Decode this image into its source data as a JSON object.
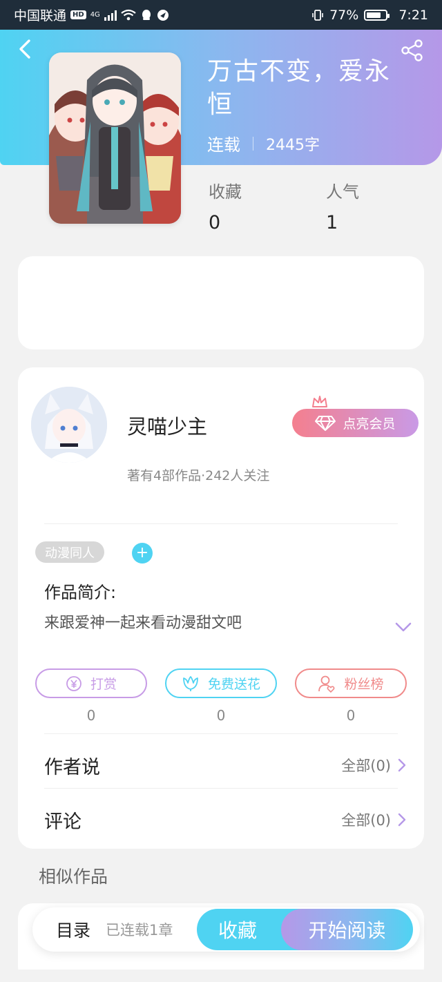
{
  "status_bar": {
    "carrier": "中国联通",
    "hd": "HD",
    "network": "4G",
    "battery_percent": "77%",
    "battery_level": 0.77,
    "time": "7:21"
  },
  "book": {
    "title": "万古不变，爱永恒",
    "status": "连载",
    "word_count": "2445字",
    "stats": [
      {
        "label": "收藏",
        "value": "0"
      },
      {
        "label": "人气",
        "value": "1"
      }
    ]
  },
  "author": {
    "name": "灵喵少主",
    "vip_label": "点亮会员",
    "stats_text": "著有4部作品·242人关注"
  },
  "tag": {
    "label": "动漫同人",
    "add_symbol": "+"
  },
  "intro": {
    "title": "作品简介:",
    "text": "来跟爱神一起来看动漫甜文吧"
  },
  "actions": [
    {
      "label": "打赏",
      "count": "0",
      "color": "#c79be6",
      "icon": "yuan-icon"
    },
    {
      "label": "免费送花",
      "count": "0",
      "color": "#4fd3f2",
      "icon": "flower-icon"
    },
    {
      "label": "粉丝榜",
      "count": "0",
      "color": "#f08a8a",
      "icon": "fan-icon"
    }
  ],
  "rows": [
    {
      "title": "作者说",
      "right": "全部(0)"
    },
    {
      "title": "评论",
      "right": "全部(0)"
    }
  ],
  "similar": {
    "title": "相似作品"
  },
  "bottom_bar": {
    "toc_label": "目录",
    "chapters_label": "已连载1章",
    "favorite_label": "收藏",
    "read_label": "开始阅读"
  },
  "colors": {
    "accent_cyan": "#4fd3f2",
    "accent_purple": "#b598e8",
    "vip_pink": "#f47f8e"
  }
}
